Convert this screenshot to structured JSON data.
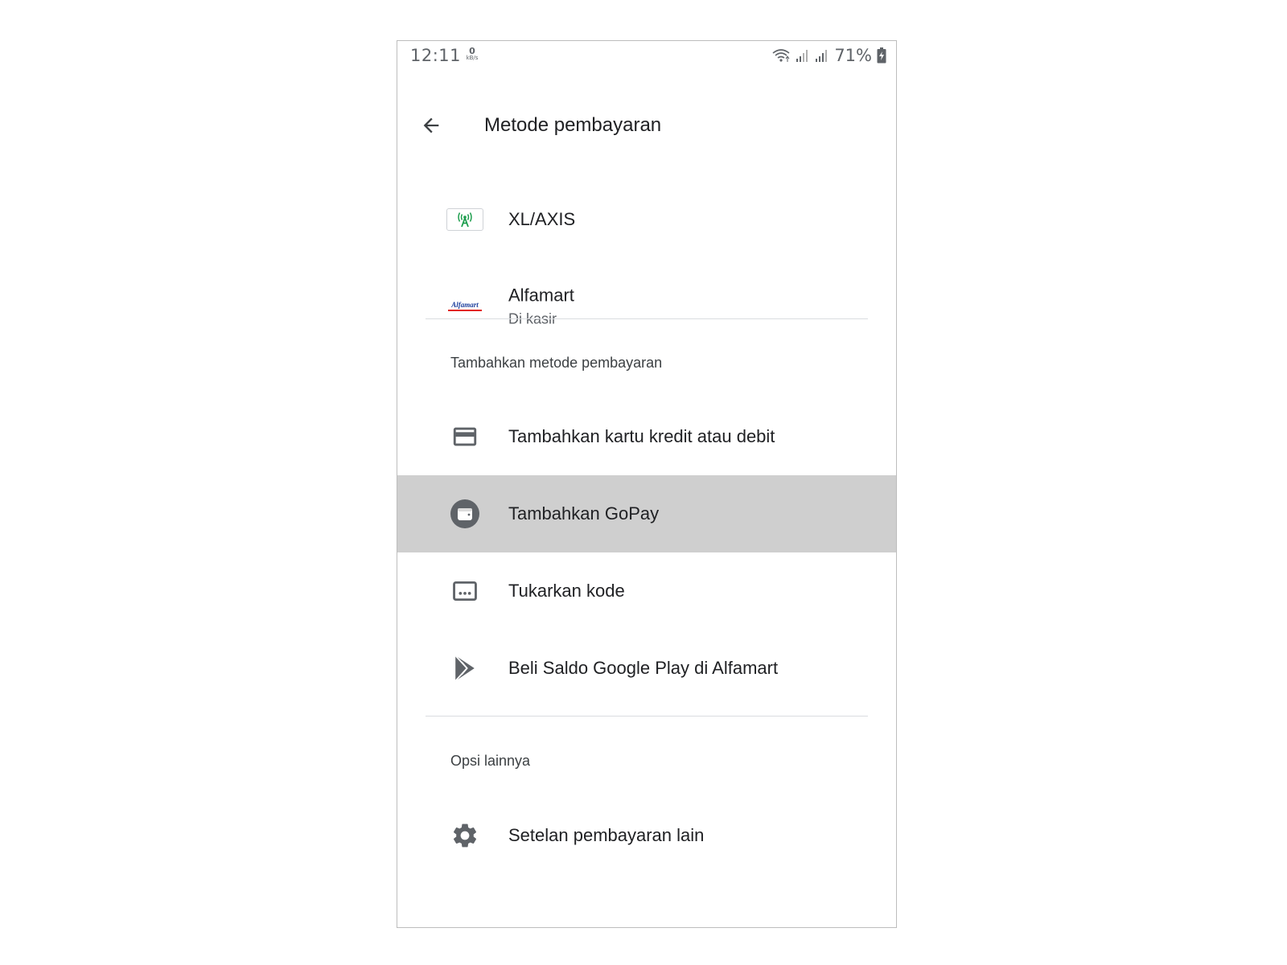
{
  "status_bar": {
    "time": "12:11",
    "net_speed_value": "0",
    "net_speed_unit": "kB/s",
    "battery_percent": "71%",
    "icons": [
      "wifi-icon",
      "signal-icon",
      "signal-icon",
      "battery-charging-icon"
    ]
  },
  "app_bar": {
    "title": "Metode pembayaran",
    "back_icon": "arrow-back-icon"
  },
  "saved_methods": [
    {
      "label": "XL/AXIS",
      "icon": "xl-axis-logo"
    },
    {
      "label": "Alfamart",
      "sublabel": "Di kasir",
      "icon": "alfamart-logo",
      "logo_text": "Alfamart"
    }
  ],
  "add_section": {
    "header": "Tambahkan metode pembayaran",
    "items": [
      {
        "label": "Tambahkan kartu kredit atau debit",
        "icon": "credit-card-icon"
      },
      {
        "label": "Tambahkan GoPay",
        "icon": "gopay-wallet-icon",
        "highlighted": true
      },
      {
        "label": "Tukarkan kode",
        "icon": "redeem-code-icon"
      },
      {
        "label": "Beli Saldo Google Play di Alfamart",
        "icon": "google-play-icon"
      }
    ]
  },
  "other_section": {
    "header": "Opsi lainnya",
    "items": [
      {
        "label": "Setelan pembayaran lain",
        "icon": "gear-icon"
      }
    ]
  },
  "colors": {
    "highlight": "#cfcfcf",
    "icon_gray": "#5f6368",
    "xl_green": "#1e9e4e",
    "alfamart_blue": "#1a3d9c",
    "alfamart_red": "#e2231a"
  }
}
